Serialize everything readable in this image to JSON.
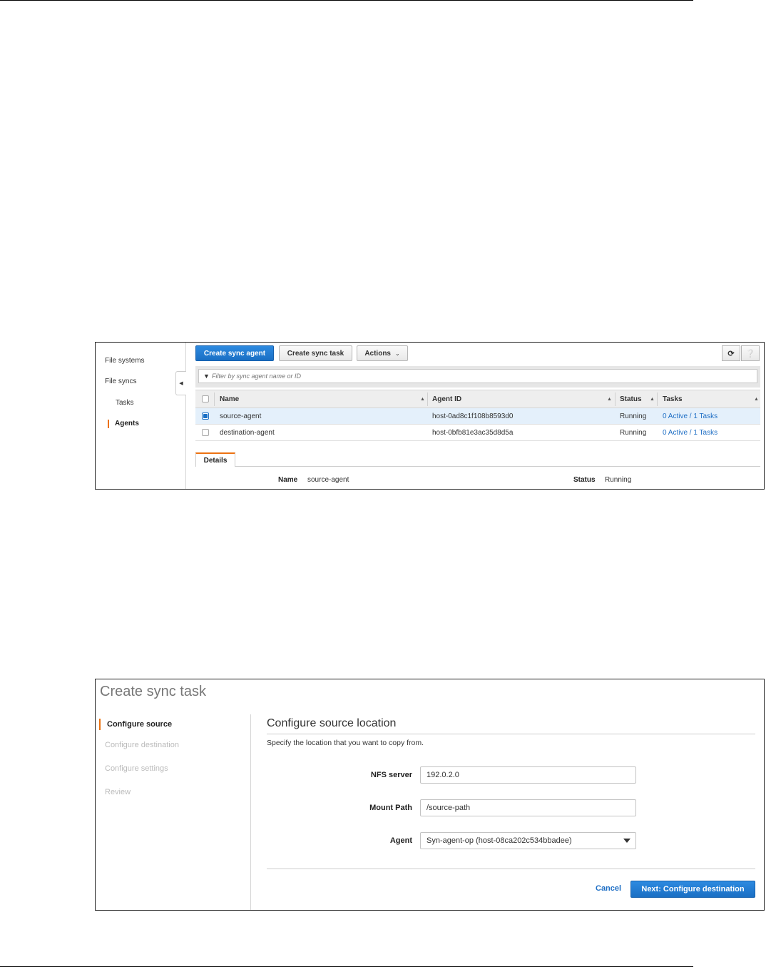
{
  "agents_console": {
    "nav": {
      "file_systems": "File systems",
      "file_syncs": "File syncs",
      "tasks": "Tasks",
      "agents": "Agents"
    },
    "toolbar": {
      "create_sync_agent": "Create sync agent",
      "create_sync_task": "Create sync task",
      "actions": "Actions",
      "refresh_icon": "refresh-icon",
      "help_icon": "help-icon"
    },
    "filter": {
      "placeholder": "Filter by sync agent name or ID"
    },
    "table": {
      "columns": [
        "Name",
        "Agent ID",
        "Status",
        "Tasks"
      ],
      "rows": [
        {
          "name": "source-agent",
          "agent_id": "host-0ad8c1f108b8593d0",
          "status": "Running",
          "tasks": "0 Active / 1 Tasks",
          "selected": true
        },
        {
          "name": "destination-agent",
          "agent_id": "host-0bfb81e3ac35d8d5a",
          "status": "Running",
          "tasks": "0 Active / 1 Tasks",
          "selected": false
        }
      ]
    },
    "details": {
      "tab": "Details",
      "name_label": "Name",
      "name_value": "source-agent",
      "status_label": "Status",
      "status_value": "Running"
    }
  },
  "create_task": {
    "title": "Create sync task",
    "steps": [
      "Configure source",
      "Configure destination",
      "Configure settings",
      "Review"
    ],
    "heading": "Configure source location",
    "description": "Specify the location that you want to copy from.",
    "fields": {
      "nfs_server_label": "NFS server",
      "nfs_server_value": "192.0.2.0",
      "mount_path_label": "Mount Path",
      "mount_path_value": "/source-path",
      "agent_label": "Agent",
      "agent_value": "Syn-agent-op (host-08ca202c534bbadee)"
    },
    "cancel": "Cancel",
    "next": "Next: Configure destination"
  },
  "colors": {
    "primary": "#1a6fc4",
    "accent": "#ec7211",
    "link": "#1f6fc5",
    "selected_row": "#e4f0fb"
  }
}
